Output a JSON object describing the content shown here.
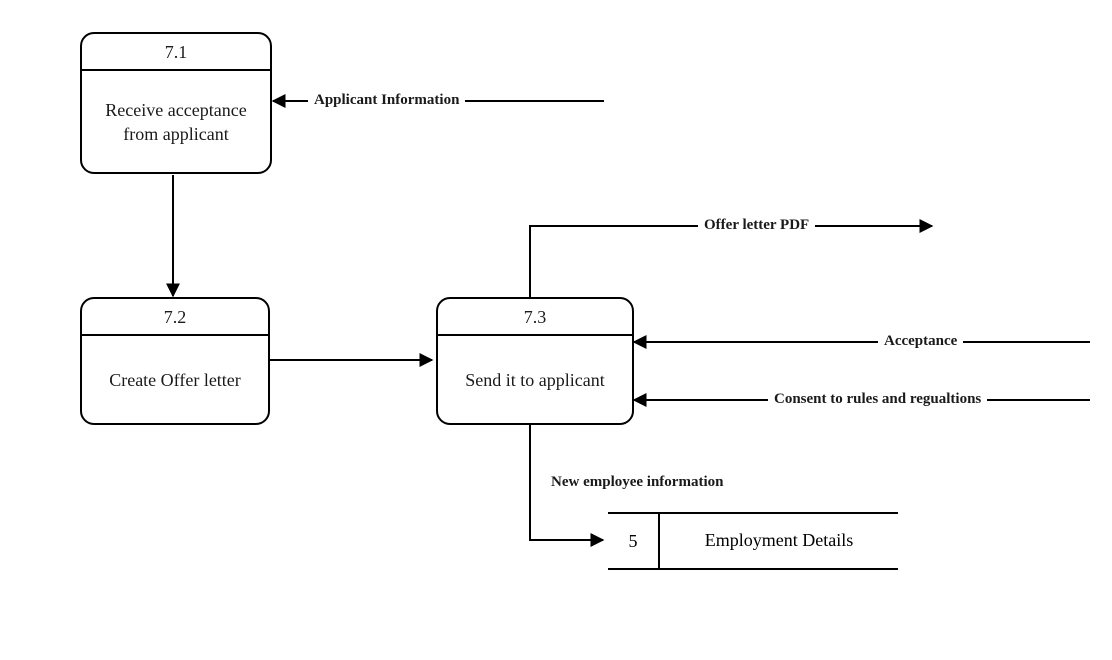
{
  "processes": {
    "p71": {
      "id": "7.1",
      "name": "Receive acceptance from applicant"
    },
    "p72": {
      "id": "7.2",
      "name": "Create Offer letter"
    },
    "p73": {
      "id": "7.3",
      "name": "Send it to applicant"
    }
  },
  "datastore": {
    "id": "5",
    "name": "Employment Details"
  },
  "flows": {
    "applicant_info": "Applicant Information",
    "offer_pdf": "Offer letter PDF",
    "acceptance": "Acceptance",
    "consent": "Consent to rules and regualtions",
    "new_emp": "New employee information"
  }
}
